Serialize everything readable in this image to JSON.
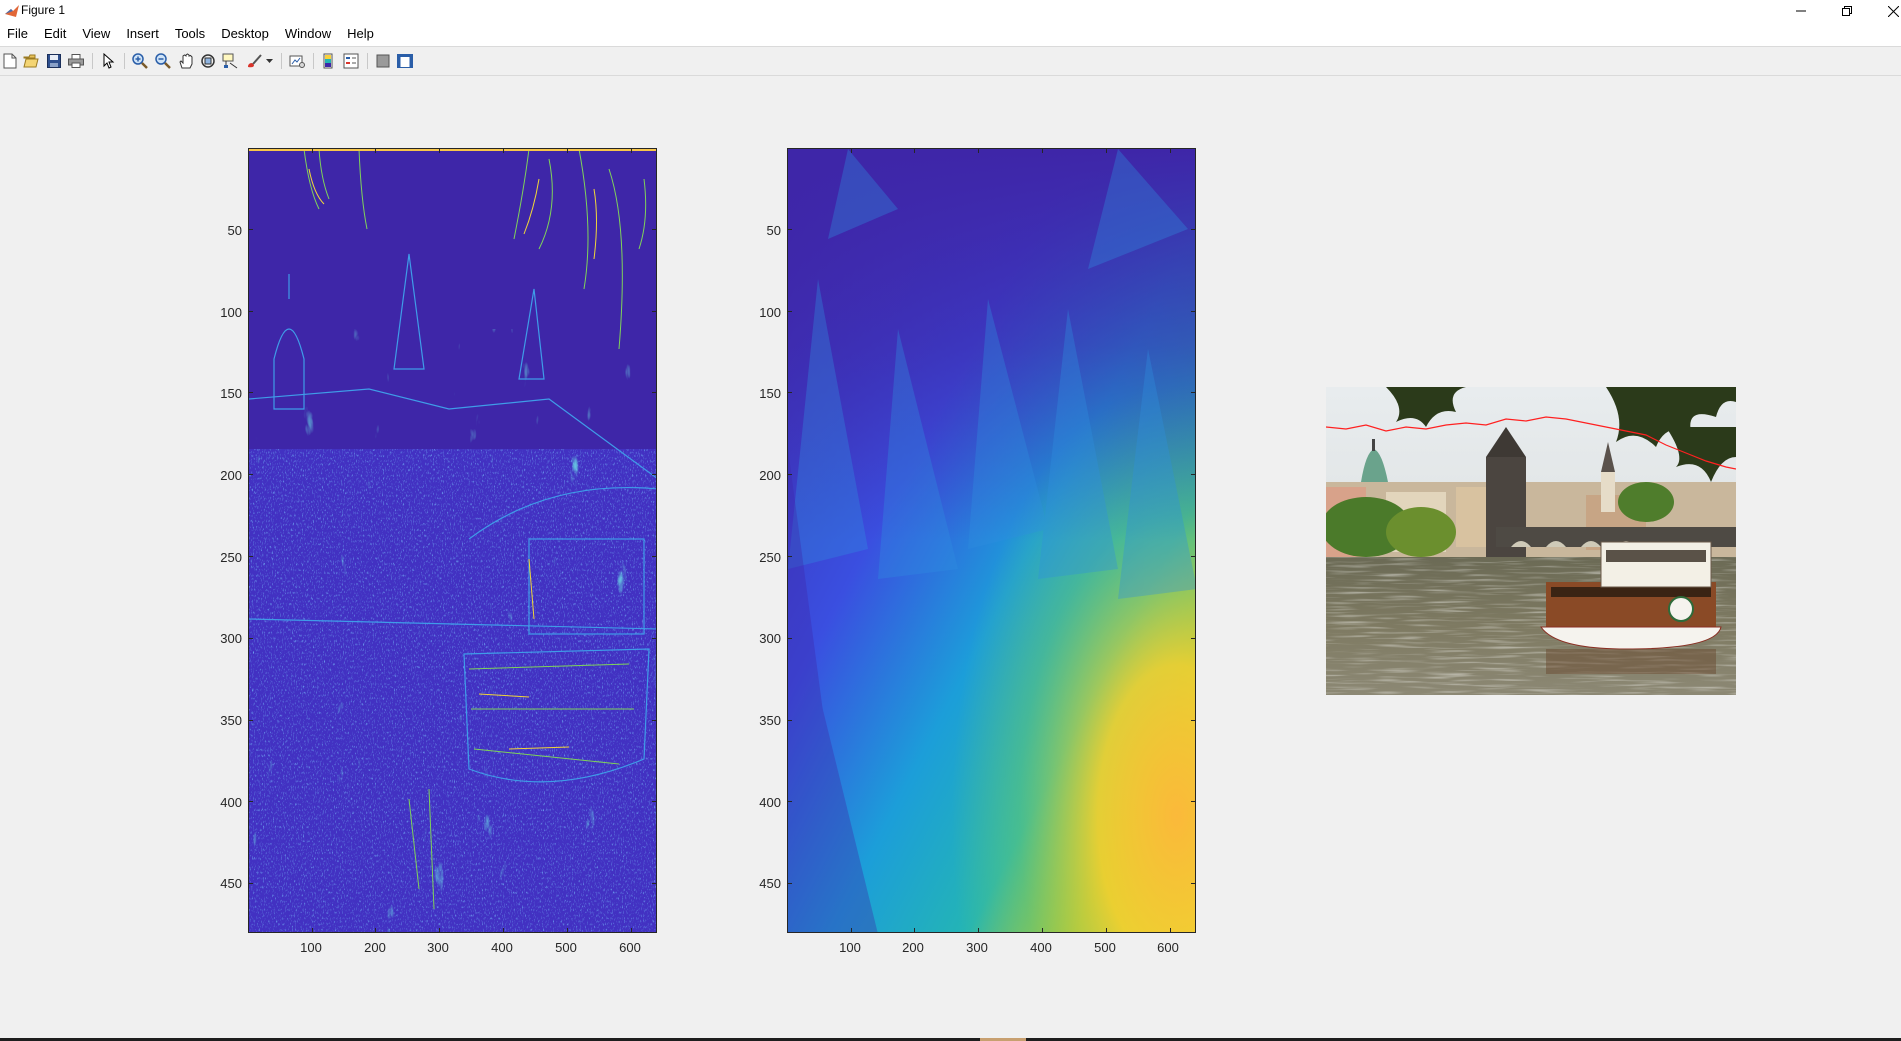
{
  "window": {
    "title": "Figure 1",
    "minimize_icon": "minimize-icon",
    "restore_icon": "restore-icon",
    "close_icon": "close-icon"
  },
  "menu": [
    "File",
    "Edit",
    "View",
    "Insert",
    "Tools",
    "Desktop",
    "Window",
    "Help"
  ],
  "toolbar": {
    "icons": [
      "new-figure-icon",
      "open-file-icon",
      "save-icon",
      "print-icon",
      "select-pointer-icon",
      "zoom-in-icon",
      "zoom-out-icon",
      "pan-hand-icon",
      "rotate-3d-icon",
      "data-cursor-icon",
      "brush-icon",
      "brush-dropdown-icon",
      "link-plot-icon",
      "insert-colorbar-icon",
      "insert-legend-icon",
      "hide-plot-tools-icon",
      "show-plot-tools-icon"
    ]
  },
  "axes1": {
    "yticks": [
      "50",
      "100",
      "150",
      "200",
      "250",
      "300",
      "350",
      "400",
      "450"
    ],
    "xticks": [
      "100",
      "200",
      "300",
      "400",
      "500",
      "600"
    ]
  },
  "axes2": {
    "yticks": [
      "50",
      "100",
      "150",
      "200",
      "250",
      "300",
      "350",
      "400",
      "450"
    ],
    "xticks": [
      "100",
      "200",
      "300",
      "400",
      "500",
      "600"
    ]
  },
  "colors": {
    "parula_low": "#3e26a8",
    "parula_mid": "#24b5b4",
    "parula_high": "#f9d23c",
    "seam_line": "#ff2020"
  }
}
